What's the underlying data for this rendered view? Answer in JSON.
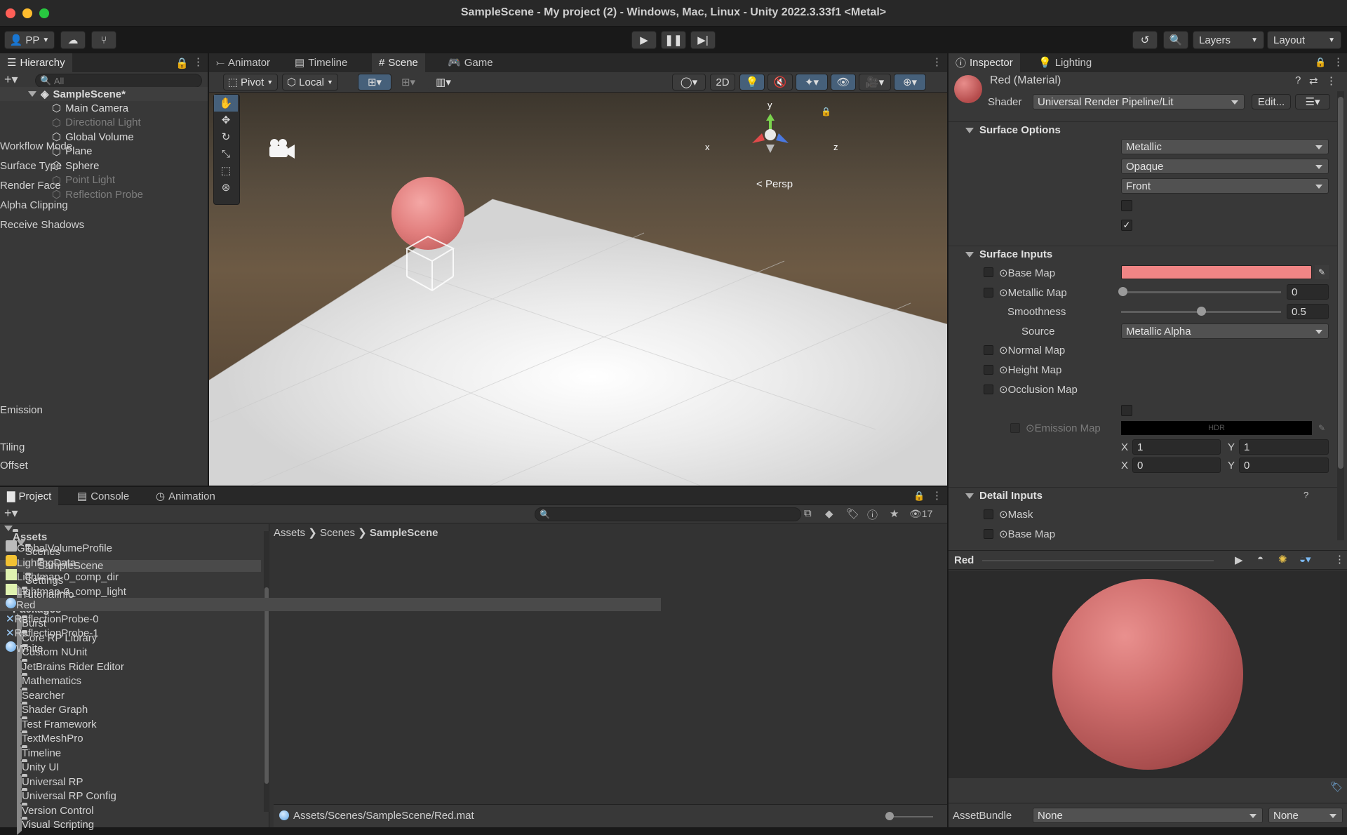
{
  "window": {
    "title": "SampleScene - My project (2) - Windows, Mac, Linux - Unity 2022.3.33f1 <Metal>"
  },
  "toolbar": {
    "account": "PP",
    "layers": "Layers",
    "layout": "Layout"
  },
  "hierarchy": {
    "tab": "Hierarchy",
    "search_placeholder": "All",
    "scene": "SampleScene*",
    "items": [
      {
        "label": "Main Camera",
        "dim": false
      },
      {
        "label": "Directional Light",
        "dim": true
      },
      {
        "label": "Global Volume",
        "dim": false
      },
      {
        "label": "Plane",
        "dim": false
      },
      {
        "label": "Sphere",
        "dim": false
      },
      {
        "label": "Point Light",
        "dim": true
      },
      {
        "label": "Reflection Probe",
        "dim": true
      }
    ]
  },
  "center_tabs": {
    "animator": "Animator",
    "timeline": "Timeline",
    "scene": "Scene",
    "game": "Game"
  },
  "scene_toolbar": {
    "pivot": "Pivot",
    "local": "Local",
    "mode_2d": "2D"
  },
  "scene_view": {
    "persp": "Persp",
    "axis_x": "x",
    "axis_y": "y",
    "axis_z": "z"
  },
  "inspector": {
    "tab": "Inspector",
    "lighting_tab": "Lighting",
    "material_name": "Red (Material)",
    "shader_label": "Shader",
    "shader_value": "Universal Render Pipeline/Lit",
    "edit_button": "Edit...",
    "surface_options": {
      "title": "Surface Options",
      "workflow_mode": {
        "label": "Workflow Mode",
        "value": "Metallic"
      },
      "surface_type": {
        "label": "Surface Type",
        "value": "Opaque"
      },
      "render_face": {
        "label": "Render Face",
        "value": "Front"
      },
      "alpha_clipping": {
        "label": "Alpha Clipping",
        "checked": false
      },
      "receive_shadows": {
        "label": "Receive Shadows",
        "checked": true
      }
    },
    "surface_inputs": {
      "title": "Surface Inputs",
      "base_map": {
        "label": "Base Map",
        "color": "#f08585"
      },
      "metallic_map": {
        "label": "Metallic Map",
        "value": "0",
        "level": 0.0
      },
      "smoothness": {
        "label": "Smoothness",
        "value": "0.5",
        "level": 0.5
      },
      "source": {
        "label": "Source",
        "value": "Metallic Alpha"
      },
      "normal_map": "Normal Map",
      "height_map": "Height Map",
      "occlusion_map": "Occlusion Map",
      "emission": {
        "label": "Emission",
        "checked": false
      },
      "emission_map": "Emission Map",
      "hdr": "HDR",
      "tiling": {
        "label": "Tiling",
        "x_label": "X",
        "x": "1",
        "y_label": "Y",
        "y": "1"
      },
      "offset": {
        "label": "Offset",
        "x_label": "X",
        "x": "0",
        "y_label": "Y",
        "y": "0"
      }
    },
    "detail_inputs": {
      "title": "Detail Inputs",
      "mask": "Mask",
      "base_map": "Base Map"
    },
    "preview": {
      "title": "Red"
    },
    "asset_bundle": {
      "label": "AssetBundle",
      "value": "None",
      "variant": "None"
    }
  },
  "bottom_tabs": {
    "project": "Project",
    "console": "Console",
    "animation": "Animation"
  },
  "project": {
    "hidden_count": "17",
    "tree": [
      {
        "label": "Assets",
        "level": 0,
        "bold": true,
        "open": true
      },
      {
        "label": "Scenes",
        "level": 1,
        "bold": false,
        "open": true
      },
      {
        "label": "SampleScene",
        "level": 2,
        "bold": false,
        "selected": true
      },
      {
        "label": "Settings",
        "level": 1,
        "bold": false
      },
      {
        "label": "TutorialInfo",
        "level": 1,
        "bold": false,
        "closed": true
      },
      {
        "label": "Packages",
        "level": 0,
        "bold": true,
        "open": true
      },
      {
        "label": "Burst",
        "level": 1,
        "closed": true
      },
      {
        "label": "Core RP Library",
        "level": 1,
        "closed": true
      },
      {
        "label": "Custom NUnit",
        "level": 1,
        "closed": true
      },
      {
        "label": "JetBrains Rider Editor",
        "level": 1,
        "closed": true
      },
      {
        "label": "Mathematics",
        "level": 1,
        "closed": true
      },
      {
        "label": "Searcher",
        "level": 1,
        "closed": true
      },
      {
        "label": "Shader Graph",
        "level": 1,
        "closed": true
      },
      {
        "label": "Test Framework",
        "level": 1,
        "closed": true
      },
      {
        "label": "TextMeshPro",
        "level": 1,
        "closed": true
      },
      {
        "label": "Timeline",
        "level": 1,
        "closed": true
      },
      {
        "label": "Unity UI",
        "level": 1,
        "closed": true
      },
      {
        "label": "Universal RP",
        "level": 1,
        "closed": true
      },
      {
        "label": "Universal RP Config",
        "level": 1,
        "closed": true
      },
      {
        "label": "Version Control",
        "level": 1,
        "closed": true
      },
      {
        "label": "Visual Scripting",
        "level": 1,
        "closed": true
      }
    ],
    "breadcrumb": [
      "Assets",
      "Scenes",
      "SampleScene"
    ],
    "assets": [
      {
        "label": "GlobalVolumeProfile",
        "icon": "volume-profile-icon"
      },
      {
        "label": "LightingData",
        "icon": "lighting-data-icon"
      },
      {
        "label": "Lightmap-0_comp_dir",
        "icon": "texture-icon"
      },
      {
        "label": "Lightmap-0_comp_light",
        "icon": "texture-icon"
      },
      {
        "label": "Red",
        "icon": "material-icon",
        "selected": true
      },
      {
        "label": "ReflectionProbe-0",
        "icon": "reflection-probe-icon"
      },
      {
        "label": "ReflectionProbe-1",
        "icon": "reflection-probe-icon"
      },
      {
        "label": "White",
        "icon": "material-icon"
      }
    ],
    "path": "Assets/Scenes/SampleScene/Red.mat"
  }
}
